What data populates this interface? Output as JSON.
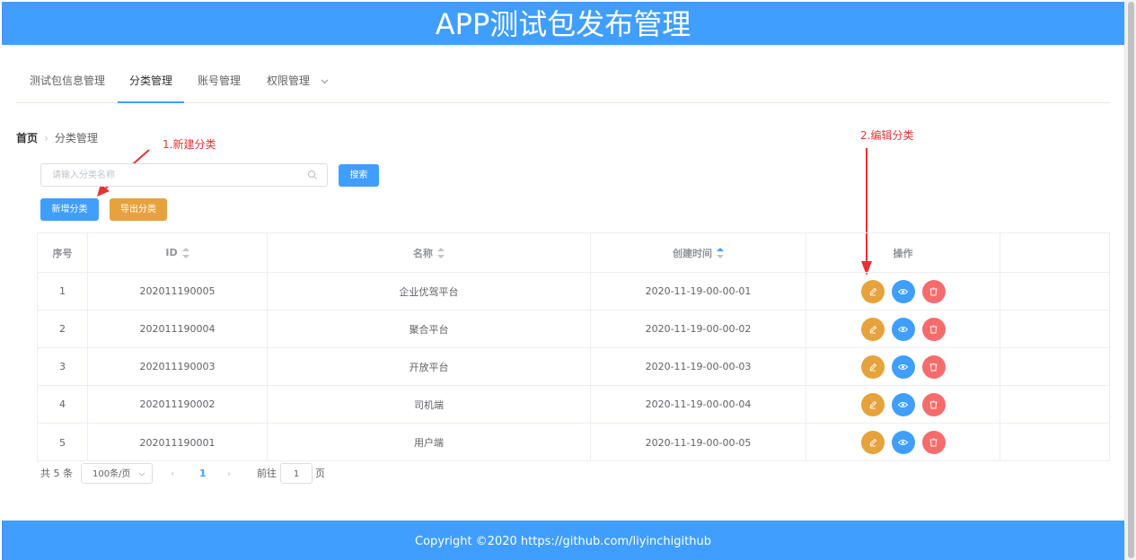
{
  "header": {
    "title": "APP测试包发布管理"
  },
  "tabs": [
    {
      "label": "测试包信息管理"
    },
    {
      "label": "分类管理"
    },
    {
      "label": "账号管理"
    },
    {
      "label": "权限管理"
    }
  ],
  "breadcrumb": {
    "home": "首页",
    "current": "分类管理"
  },
  "annotations": {
    "new_category": "1.新建分类",
    "edit_category": "2.编辑分类",
    "color": "#e53333"
  },
  "search": {
    "placeholder": "请输入分类名称",
    "search_button": "搜索"
  },
  "actions": {
    "add_button": "新增分类",
    "export_button": "导出分类"
  },
  "table": {
    "headers": {
      "index": "序号",
      "id": "ID",
      "name": "名称",
      "created": "创建时间",
      "ops": "操作"
    },
    "rows": [
      {
        "index": "1",
        "id": "202011190005",
        "name": "企业优驾平台",
        "created": "2020-11-19-00-00-01"
      },
      {
        "index": "2",
        "id": "202011190004",
        "name": "聚合平台",
        "created": "2020-11-19-00-00-02"
      },
      {
        "index": "3",
        "id": "202011190003",
        "name": "开放平台",
        "created": "2020-11-19-00-00-03"
      },
      {
        "index": "4",
        "id": "202011190002",
        "name": "司机端",
        "created": "2020-11-19-00-00-04"
      },
      {
        "index": "5",
        "id": "202011190001",
        "name": "用户端",
        "created": "2020-11-19-00-00-05"
      }
    ]
  },
  "pagination": {
    "total": "共 5 条",
    "page_size": "100条/页",
    "current_page": "1",
    "goto_prefix": "前往",
    "goto_value": "1",
    "goto_suffix": "页"
  },
  "footer": {
    "copyright": "Copyright ©2020",
    "link": "https://github.com/liyinchigithub"
  },
  "colors": {
    "primary": "#409eff",
    "warning": "#e6a23c",
    "danger": "#f56c6c"
  }
}
